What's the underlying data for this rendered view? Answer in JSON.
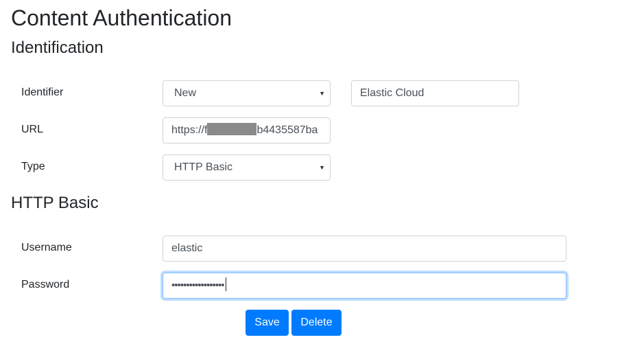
{
  "page": {
    "title": "Content Authentication"
  },
  "identification": {
    "heading": "Identification",
    "identifier": {
      "label": "Identifier",
      "selected": "New",
      "name_value": "Elastic Cloud"
    },
    "url": {
      "label": "URL",
      "value_prefix": "https://f",
      "value_suffix": "b4435587ba"
    },
    "type": {
      "label": "Type",
      "selected": "HTTP Basic"
    }
  },
  "http_basic": {
    "heading": "HTTP Basic",
    "username": {
      "label": "Username",
      "value": "elastic"
    },
    "password": {
      "label": "Password",
      "masked_value": "••••••••••••••••••"
    }
  },
  "actions": {
    "save_label": "Save",
    "delete_label": "Delete"
  },
  "colors": {
    "primary": "#007bff",
    "focus_border": "#80bdff"
  }
}
